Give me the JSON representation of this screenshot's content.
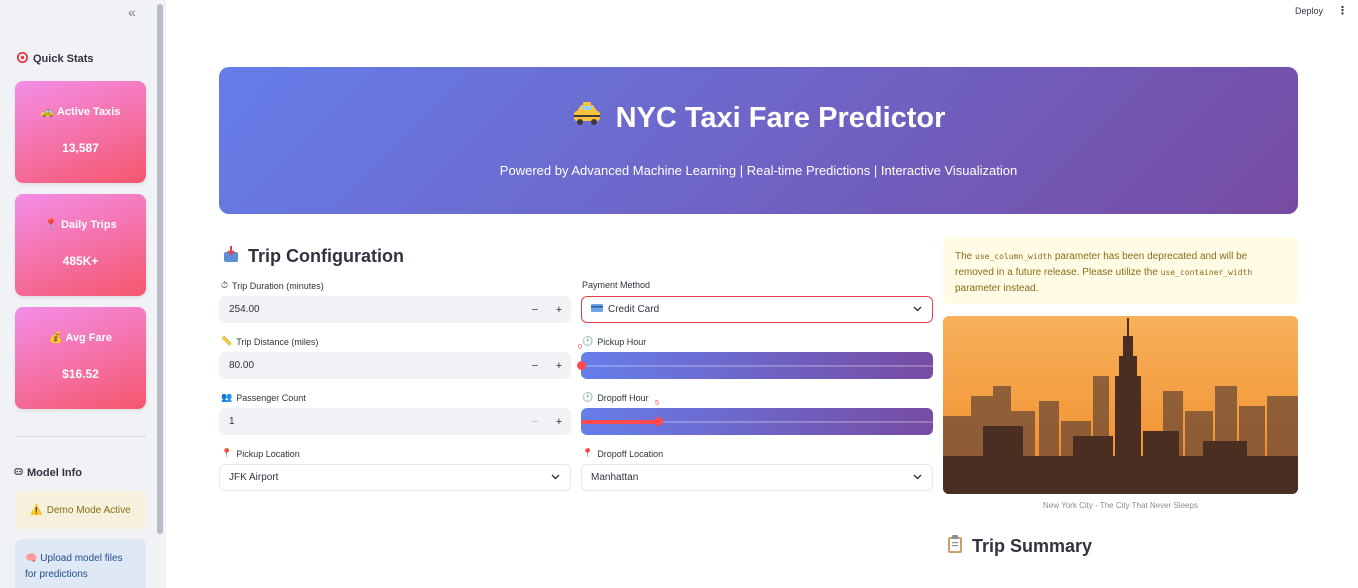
{
  "toolbar": {
    "deploy_label": "Deploy"
  },
  "sidebar": {
    "quick_stats_title": "Quick Stats",
    "stats": [
      {
        "label": "Active Taxis",
        "value": "13,587",
        "icon": "taxi-icon"
      },
      {
        "label": "Daily Trips",
        "value": "485K+",
        "icon": "pin-icon"
      },
      {
        "label": "Avg Fare",
        "value": "$16.52",
        "icon": "money-bag-icon"
      }
    ],
    "model_info_title": "Model Info",
    "demo_mode_label": "Demo Mode Active",
    "upload_hint": "Upload model files for predictions"
  },
  "hero": {
    "title": "NYC Taxi Fare Predictor",
    "subtitle": "Powered by Advanced Machine Learning | Real-time Predictions | Interactive Visualization"
  },
  "trip_config": {
    "title": "Trip Configuration",
    "trip_duration": {
      "label": "Trip Duration (minutes)",
      "value": "254.00"
    },
    "trip_distance": {
      "label": "Trip Distance (miles)",
      "value": "80.00"
    },
    "passenger_count": {
      "label": "Passenger Count",
      "value": "1"
    },
    "pickup_location": {
      "label": "Pickup Location",
      "value": "JFK Airport"
    },
    "payment_method": {
      "label": "Payment Method",
      "value": "Credit Card"
    },
    "pickup_hour": {
      "label": "Pickup Hour",
      "value": "0",
      "fraction": 0.0
    },
    "dropoff_hour": {
      "label": "Dropoff Hour",
      "value": "5",
      "fraction": 0.2174
    },
    "dropoff_location": {
      "label": "Dropoff Location",
      "value": "Manhattan"
    }
  },
  "warning": {
    "part1": "The ",
    "code1": "use_column_width",
    "part2": " parameter has been deprecated and will be removed in a future release. Please utilize the ",
    "code2": "use_container_width",
    "part3": " parameter instead."
  },
  "image_caption": "New York City - The City That Never Sleeps",
  "trip_summary_title": "Trip Summary",
  "colors": {
    "accent": "#ff4b4b",
    "hero_start": "#667eea",
    "hero_end": "#764ba2",
    "card_start": "#f38ee8",
    "card_end": "#f5576c"
  }
}
